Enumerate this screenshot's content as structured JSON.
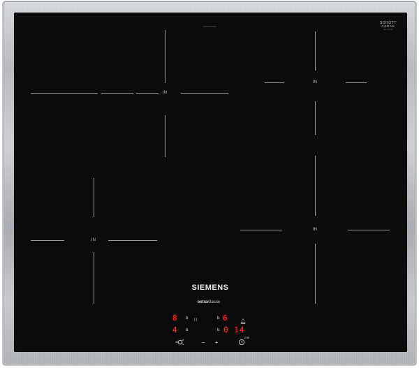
{
  "cooktop": {
    "model_number": "EH645FHB1E",
    "schott_line1": "SCHOTT",
    "schott_line2": "CERAN",
    "schott_line3": "EU 1010 R",
    "zone_label": "IN",
    "brand": "SIEMENS",
    "series_prefix": "extra",
    "series_suffix": "Klasse"
  },
  "display": {
    "row1_left_digit": "8",
    "row1_left_b": "b",
    "row1_link_icon": "|-|",
    "row1_right_b": "b",
    "row1_right_digit": "6",
    "row2_left_digit": "4",
    "row2_left_b": "b",
    "row2_right_b": "b",
    "row2_timer": "0 14",
    "min_label": "min"
  },
  "controls": {
    "main_switch_icon": "power-key-icon",
    "minus_label": "−",
    "plus_label": "+",
    "timer_icon": "clock-icon",
    "bell_icon": "bell-icon"
  },
  "colors": {
    "glass": "#0b0b0b",
    "display_red": "#ff2a2a",
    "print_grey": "#9a9a9a"
  }
}
